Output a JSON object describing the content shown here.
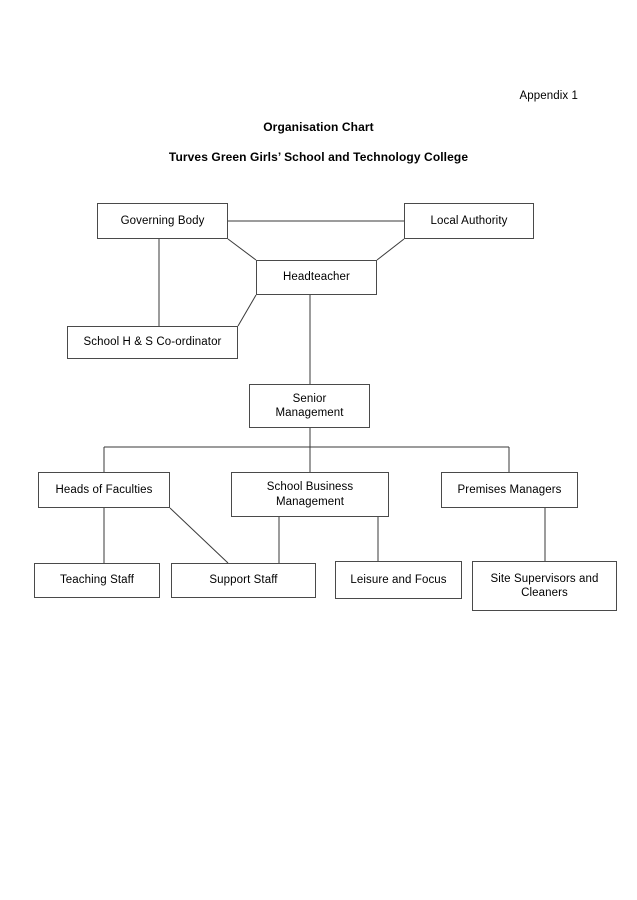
{
  "document": {
    "appendix_label": "Appendix 1",
    "title": "Organisation Chart",
    "subtitle": "Turves Green Girls’ School and Technology College"
  },
  "chart_data": {
    "type": "diagram",
    "diagram_type": "organisation-chart",
    "title": "Organisation Chart",
    "subtitle": "Turves Green Girls’ School and Technology College",
    "nodes": [
      {
        "id": "governing_body",
        "label": "Governing Body",
        "tier": 1
      },
      {
        "id": "local_authority",
        "label": "Local Authority",
        "tier": 1
      },
      {
        "id": "headteacher",
        "label": "Headteacher",
        "tier": 2
      },
      {
        "id": "school_hs",
        "label": "School H & S Co-ordinator",
        "tier": 2
      },
      {
        "id": "senior_mgmt",
        "label": "Senior\nManagement",
        "tier": 3
      },
      {
        "id": "heads_faculties",
        "label": "Heads of Faculties",
        "tier": 4
      },
      {
        "id": "school_business",
        "label": "School Business\nManagement",
        "tier": 4
      },
      {
        "id": "premises_mgrs",
        "label": "Premises Managers",
        "tier": 4
      },
      {
        "id": "teaching_staff",
        "label": "Teaching Staff",
        "tier": 5
      },
      {
        "id": "support_staff",
        "label": "Support Staff",
        "tier": 5
      },
      {
        "id": "leisure_focus",
        "label": "Leisure and Focus",
        "tier": 5
      },
      {
        "id": "site_supervisors",
        "label": "Site Supervisors and\nCleaners",
        "tier": 5
      }
    ],
    "edges": [
      {
        "from": "governing_body",
        "to": "local_authority"
      },
      {
        "from": "governing_body",
        "to": "headteacher"
      },
      {
        "from": "local_authority",
        "to": "headteacher"
      },
      {
        "from": "governing_body",
        "to": "school_hs"
      },
      {
        "from": "headteacher",
        "to": "school_hs"
      },
      {
        "from": "headteacher",
        "to": "senior_mgmt"
      },
      {
        "from": "senior_mgmt",
        "to": "heads_faculties"
      },
      {
        "from": "senior_mgmt",
        "to": "school_business"
      },
      {
        "from": "senior_mgmt",
        "to": "premises_mgrs"
      },
      {
        "from": "heads_faculties",
        "to": "teaching_staff"
      },
      {
        "from": "heads_faculties",
        "to": "support_staff"
      },
      {
        "from": "school_business",
        "to": "support_staff"
      },
      {
        "from": "school_business",
        "to": "leisure_focus"
      },
      {
        "from": "premises_mgrs",
        "to": "site_supervisors"
      }
    ],
    "colors": {
      "box_border": "#4a4a4a",
      "connector": "#3a3a3a",
      "background": "#ffffff",
      "text": "#000000"
    }
  }
}
